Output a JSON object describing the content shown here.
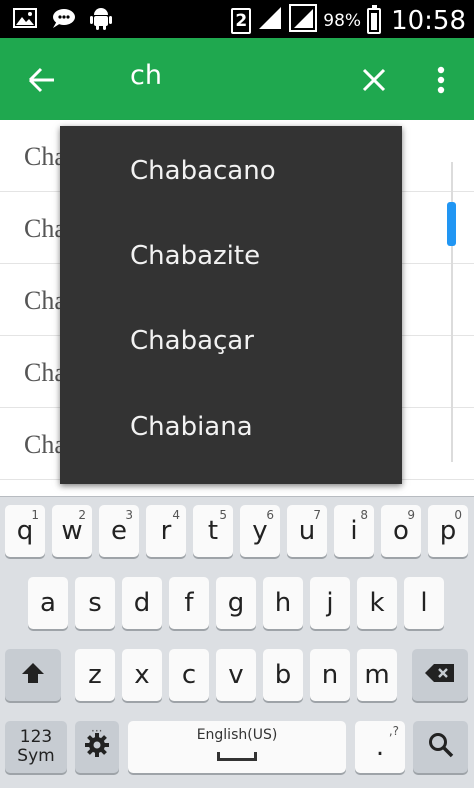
{
  "status_bar": {
    "sim_label": "2",
    "battery_percent": "98%",
    "time": "10:58",
    "left_icons": [
      "gallery-icon",
      "chat-bubble-icon",
      "android-icon"
    ]
  },
  "toolbar": {
    "query": "ch",
    "color": "#1fa84f"
  },
  "list": {
    "items": [
      "Cha",
      "Cha",
      "Cha",
      "Cha",
      "Cha"
    ]
  },
  "suggestions": [
    "Chabacano",
    "Chabazite",
    "Chabaçar",
    "Chabiana"
  ],
  "keyboard": {
    "row1": [
      {
        "key": "q",
        "hint": "1"
      },
      {
        "key": "w",
        "hint": "2"
      },
      {
        "key": "e",
        "hint": "3"
      },
      {
        "key": "r",
        "hint": "4"
      },
      {
        "key": "t",
        "hint": "5"
      },
      {
        "key": "y",
        "hint": "6"
      },
      {
        "key": "u",
        "hint": "7"
      },
      {
        "key": "i",
        "hint": "8"
      },
      {
        "key": "o",
        "hint": "9"
      },
      {
        "key": "p",
        "hint": "0"
      }
    ],
    "row2": [
      "a",
      "s",
      "d",
      "f",
      "g",
      "h",
      "j",
      "k",
      "l"
    ],
    "row3": [
      "z",
      "x",
      "c",
      "v",
      "b",
      "n",
      "m"
    ],
    "symbols_key": "123\nSym",
    "space_label": "English(US)",
    "punct_key": ".",
    "punct_hint": ",?"
  }
}
